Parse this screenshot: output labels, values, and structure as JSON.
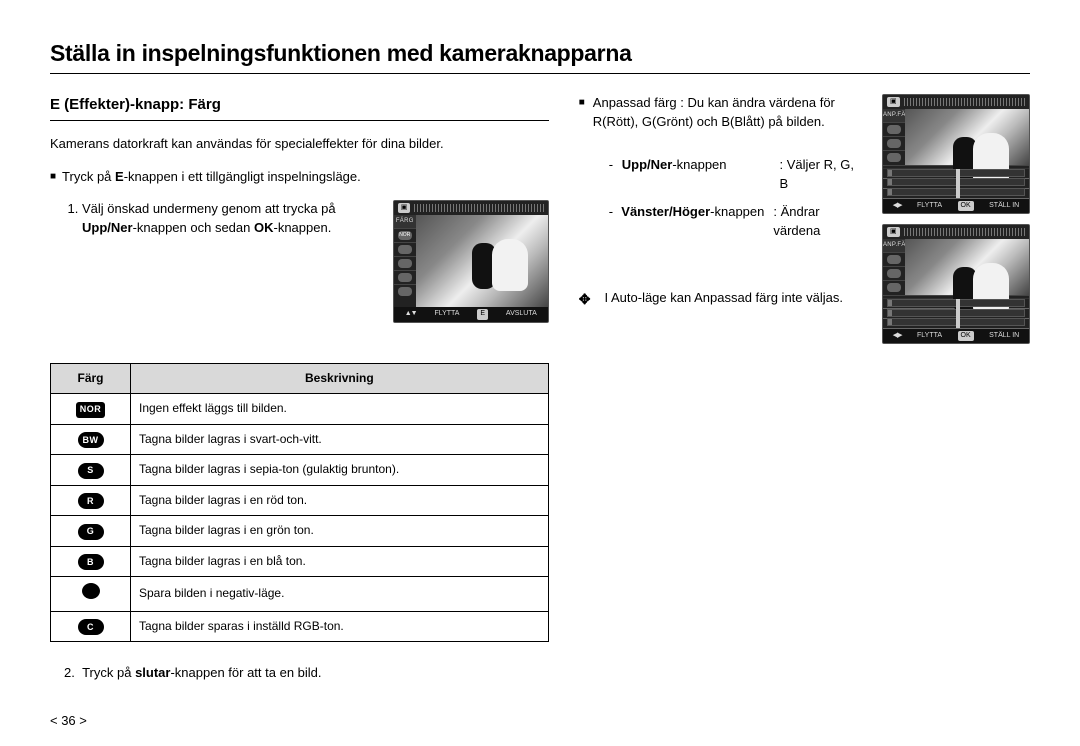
{
  "page_title": "Ställa in inspelningsfunktionen med kameraknapparna",
  "section_title": "E (Effekter)-knapp: Färg",
  "intro": "Kamerans datorkraft kan användas för specialeffekter för dina bilder.",
  "bullet1_pre": "Tryck på ",
  "bullet1_bold": "E",
  "bullet1_post": "-knappen i ett tillgängligt inspelningsläge.",
  "step1_line1": "Välj önskad undermeny genom att trycka på",
  "step1_line2a": "Upp/Ner",
  "step1_line2b": "-knappen och sedan ",
  "step1_line2c": "OK",
  "step1_line2d": "-knappen.",
  "step2_pre": "Tryck på ",
  "step2_bold": "slutar",
  "step2_post": "-knappen för att ta en bild.",
  "table": {
    "col1": "Färg",
    "col2": "Beskrivning",
    "rows": [
      {
        "icon": "NOR",
        "shape": "rect",
        "desc": "Ingen effekt läggs till bilden."
      },
      {
        "icon": "BW",
        "shape": "pill",
        "desc": "Tagna bilder lagras i svart-och-vitt."
      },
      {
        "icon": "S",
        "shape": "pill",
        "desc": "Tagna bilder lagras i sepia-ton (gulaktig brunton)."
      },
      {
        "icon": "R",
        "shape": "pill",
        "desc": "Tagna bilder lagras i en röd ton."
      },
      {
        "icon": "G",
        "shape": "pill",
        "desc": "Tagna bilder lagras i en grön ton."
      },
      {
        "icon": "B",
        "shape": "pill",
        "desc": "Tagna bilder lagras i en blå ton."
      },
      {
        "icon": "",
        "shape": "circ",
        "desc": "Spara bilden i negativ-läge."
      },
      {
        "icon": "C",
        "shape": "pill",
        "desc": "Tagna bilder sparas i inställd RGB-ton."
      }
    ]
  },
  "custom_bullet": "Anpassad färg : Du kan ändra värdena för R(Rött), G(Grönt) och B(Blått) på bilden.",
  "ctl": {
    "updown_k": "Upp/Ner",
    "updown_suffix": "-knappen",
    "updown_v": ": Väljer R, G, B",
    "lr_k": "Vänster/Höger",
    "lr_suffix": "-knappen",
    "lr_v": ": Ändrar värdena"
  },
  "info_note": "I Auto-läge kan Anpassad färg inte väljas.",
  "page_number": "< 36 >",
  "cam1": {
    "label": "FÄRG",
    "footer_move": "FLYTTA",
    "footer_mid": "E",
    "footer_exit": "AVSLUTA"
  },
  "cam2": {
    "label": "ANP.FÄRG",
    "footer_move": "FLYTTA",
    "footer_mid": "OK",
    "footer_set": "STÄLL IN"
  }
}
